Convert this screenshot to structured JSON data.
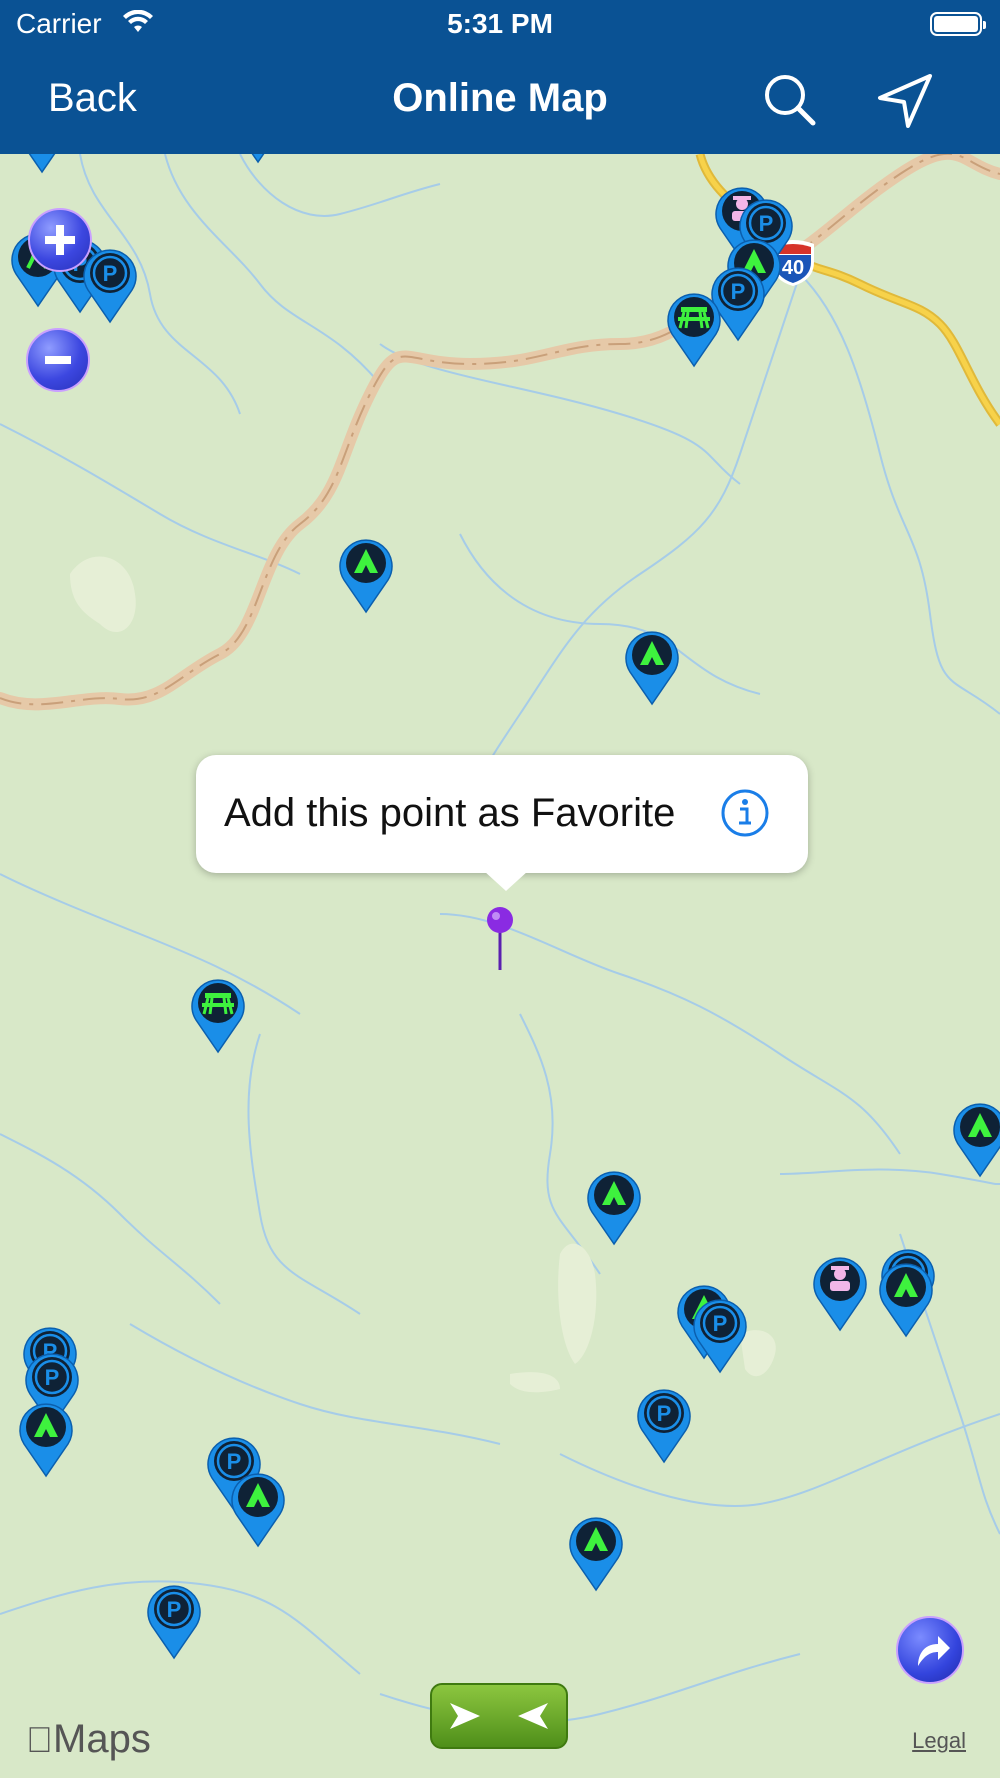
{
  "status_bar": {
    "carrier": "Carrier",
    "time": "5:31 PM"
  },
  "nav": {
    "back_label": "Back",
    "title": "Online Map"
  },
  "map": {
    "callout_text": "Add this point as Favorite",
    "highway_shield": "40",
    "attribution": "Maps",
    "legal": "Legal"
  },
  "colors": {
    "nav_bg": "#0a5294",
    "map_bg": "#d8e8c8",
    "pin_blue": "#1a8ee8",
    "camping_green": "#3ef23e",
    "favorite_pin": "#7a2cd8"
  },
  "icons": {
    "pin_types": [
      "parking-icon",
      "camping-icon",
      "picnic-icon",
      "hiking-icon",
      "ranger-icon"
    ]
  }
}
